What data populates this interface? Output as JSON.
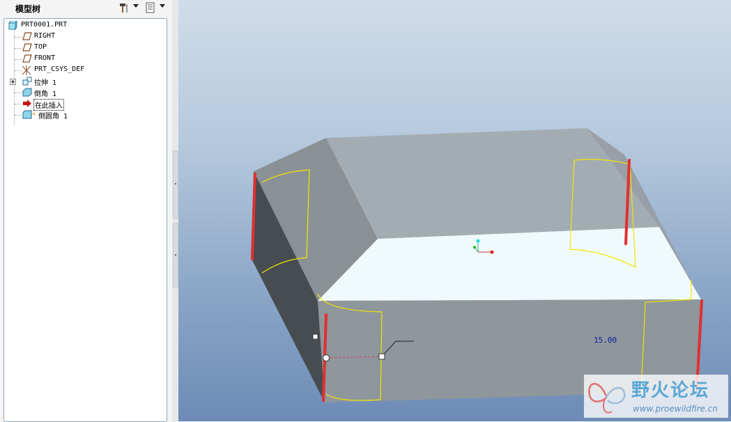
{
  "panel": {
    "title": "模型树",
    "tools_icon": "hammer-wrench-icon",
    "display_icon": "list-settings-icon"
  },
  "tree": {
    "items": [
      {
        "label": "PRT0001.PRT",
        "icon": "part-icon"
      },
      {
        "label": "RIGHT",
        "icon": "datum-plane-icon"
      },
      {
        "label": "TOP",
        "icon": "datum-plane-icon"
      },
      {
        "label": "FRONT",
        "icon": "datum-plane-icon"
      },
      {
        "label": "PRT_CSYS_DEF",
        "icon": "coordinate-system-icon"
      },
      {
        "label": "拉伸 1",
        "icon": "extrude-icon"
      },
      {
        "label": "倒角 1",
        "icon": "chamfer-icon"
      },
      {
        "label": "在此插入",
        "icon": "insert-here-arrow-icon"
      },
      {
        "label": "倒圆角 1",
        "icon": "round-icon"
      }
    ]
  },
  "viewport": {
    "dimension_value": "15.00"
  },
  "watermark": {
    "title": "野火论坛",
    "url": "www.proewildfire.cn"
  },
  "colors": {
    "edge_highlight": "#e03030",
    "preview_curve": "#f2e600",
    "top_face": "#f0fafc"
  }
}
